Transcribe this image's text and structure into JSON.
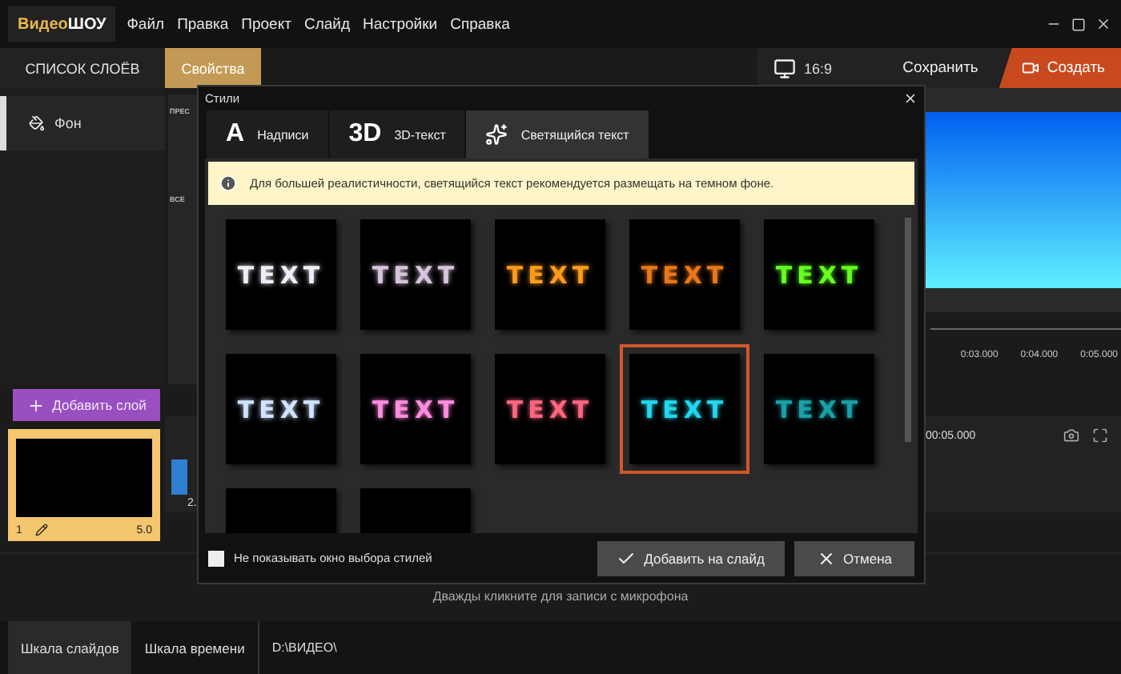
{
  "app": {
    "logo_first": "Видео",
    "logo_second": "ШОУ",
    "menu": [
      "Файл",
      "Правка",
      "Проект",
      "Слайд",
      "Настройки",
      "Справка"
    ]
  },
  "left_tabs": [
    {
      "label": "СПИСОК СЛОЁВ",
      "selected": false
    },
    {
      "label": "Свойства",
      "selected": true
    }
  ],
  "layers": [
    {
      "label": "Фон",
      "selected": true
    }
  ],
  "properties": {
    "section_1": "ПРЕС",
    "section_2": "ВСЕ"
  },
  "toolbar": {
    "aspect": "16:9",
    "save": "Сохранить",
    "create": "Создать"
  },
  "timeline": {
    "ticks": [
      "0:03.000",
      "0:04.000",
      "0:05.000"
    ],
    "duration": "00:05.000"
  },
  "add_layer": "Добавить слой",
  "slides": [
    {
      "number": "1",
      "duration": "5.0",
      "selected": true
    }
  ],
  "transition_label": "2.",
  "mic_hint": "Дважды кликните для записи с микрофона",
  "bottom_tabs": [
    {
      "label": "Шкала слайдов",
      "selected": true
    },
    {
      "label": "Шкала времени",
      "selected": false
    }
  ],
  "path": "D:\\ВИДЕО\\",
  "dialog": {
    "title": "Стили",
    "tabs": [
      {
        "kind": "letter",
        "icon": "A",
        "label": "Надписи",
        "selected": false
      },
      {
        "kind": "letter",
        "icon": "3D",
        "label": "3D-текст",
        "selected": false
      },
      {
        "kind": "sparkle",
        "label": "Светящийся текст",
        "selected": true
      }
    ],
    "info": "Для большей реалистичности, светящийся текст рекомендуется размещать на темном фоне.",
    "styles": [
      {
        "label": "TEXT",
        "color": "#eeeef8",
        "selected": false
      },
      {
        "label": "TEXT",
        "color": "#d8c4dc",
        "selected": false
      },
      {
        "label": "TEXT",
        "color": "#ff9c1c",
        "selected": false
      },
      {
        "label": "TEXT",
        "color": "#e8781a",
        "selected": false
      },
      {
        "label": "TEXT",
        "color": "#66ff22",
        "selected": false
      },
      {
        "label": "TEXT",
        "color": "#d0e4ff",
        "selected": false
      },
      {
        "label": "TEXT",
        "color": "#ff8ce0",
        "selected": false
      },
      {
        "label": "TEXT",
        "color": "#ff6680",
        "selected": false
      },
      {
        "label": "TEXT",
        "color": "#22d8f0",
        "selected": true
      },
      {
        "label": "TEXT",
        "color": "#1aa0a8",
        "selected": false
      },
      {
        "selected": false
      },
      {
        "selected": false
      }
    ],
    "checkbox": {
      "label": "Не показывать окно выбора стилей",
      "checked": false
    },
    "buttons": [
      {
        "kind": "confirm",
        "label": "Добавить на слайд"
      },
      {
        "kind": "cancel",
        "label": "Отмена"
      }
    ]
  }
}
